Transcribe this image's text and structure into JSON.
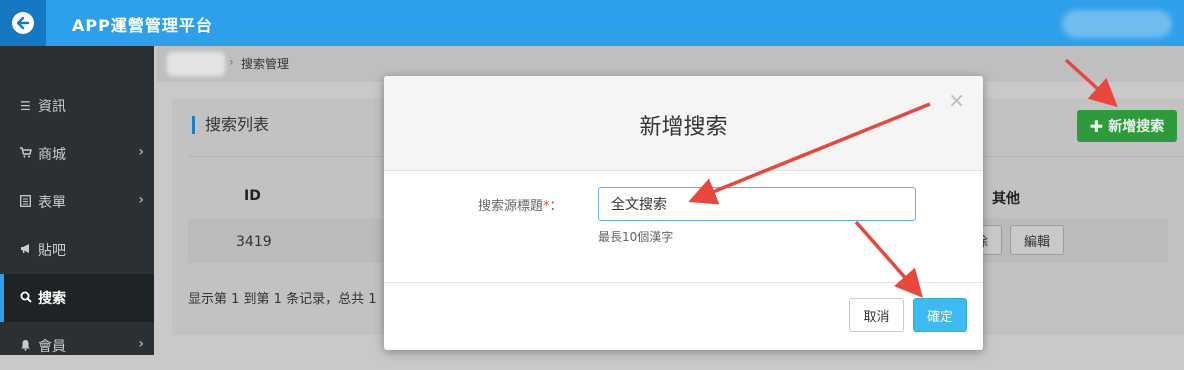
{
  "app": {
    "title": "APP運營管理平台"
  },
  "sidebar": {
    "items": [
      {
        "icon": "list-icon",
        "label": "資訊",
        "has_submenu": false
      },
      {
        "icon": "cart-icon",
        "label": "商城",
        "has_submenu": true
      },
      {
        "icon": "form-icon",
        "label": "表單",
        "has_submenu": true
      },
      {
        "icon": "megaphone-icon",
        "label": "貼吧",
        "has_submenu": false
      },
      {
        "icon": "search-icon",
        "label": "搜索",
        "has_submenu": false,
        "active": true
      },
      {
        "icon": "bell-icon",
        "label": "會員",
        "has_submenu": true
      }
    ]
  },
  "breadcrumb": {
    "current": "搜索管理"
  },
  "panel": {
    "title": "搜索列表",
    "add_button": "新增搜索",
    "columns": {
      "id": "ID",
      "other": "其他"
    },
    "rows": [
      {
        "id": "3419",
        "delete_label": "除",
        "edit_label": "編輯"
      }
    ],
    "footer": "显示第 1 到第 1 条记录，总共 1"
  },
  "modal": {
    "title": "新增搜索",
    "close": "×",
    "field_label": "搜索源標題",
    "required_mark": "*",
    "colon": "：",
    "field_value": "全文搜索",
    "help": "最長10個漢字",
    "cancel": "取消",
    "confirm": "確定"
  },
  "colors": {
    "topbar": "#2e9fea",
    "sidebar": "#2b3034",
    "add_button": "#2e9a3c",
    "confirm_button": "#3dbbf0",
    "arrow": "#e8473b"
  }
}
